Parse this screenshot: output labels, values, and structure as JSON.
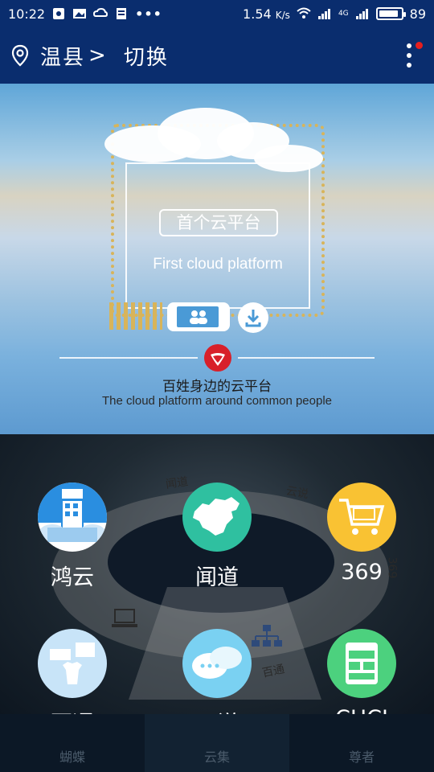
{
  "status_bar": {
    "time": "10:22",
    "network_speed": "1.54",
    "speed_unit": "K/s",
    "battery_level": "89",
    "battery_fraction": 0.89,
    "signal_label": "4G"
  },
  "app_bar": {
    "city": "温县",
    "city_chevron": ">",
    "switch_label": "切换",
    "notification_dot_color": "#e51e1e",
    "background_color": "#0a2d6e"
  },
  "banner": {
    "title_cn": "首个云平台",
    "subtitle_en": "First cloud platform",
    "slogan_cn": "百姓身边的云平台",
    "slogan_en": "The cloud platform around common people"
  },
  "apps": [
    {
      "name": "鸿云",
      "icon": "store-sale-icon",
      "color": "#ffffff"
    },
    {
      "name": "闻道",
      "icon": "china-map-icon",
      "color": "#2fc0a0"
    },
    {
      "name": "369",
      "icon": "shopping-cart-icon",
      "color": "#f9c233"
    },
    {
      "name": "百通",
      "icon": "devices-icon",
      "color": "#c8e4f8"
    },
    {
      "name": "云说",
      "icon": "chat-bubbles-icon",
      "color": "#7ad1f2"
    },
    {
      "name": "CHCI",
      "icon": "window-app-icon",
      "color": "#4cd17e"
    }
  ],
  "background_labels": {
    "top_left": "闻道",
    "top_right": "云说",
    "right": "369",
    "bottom": "百通"
  },
  "bottom_nav": [
    {
      "label": "蝴蝶"
    },
    {
      "label": "云集"
    },
    {
      "label": "尊者"
    }
  ]
}
